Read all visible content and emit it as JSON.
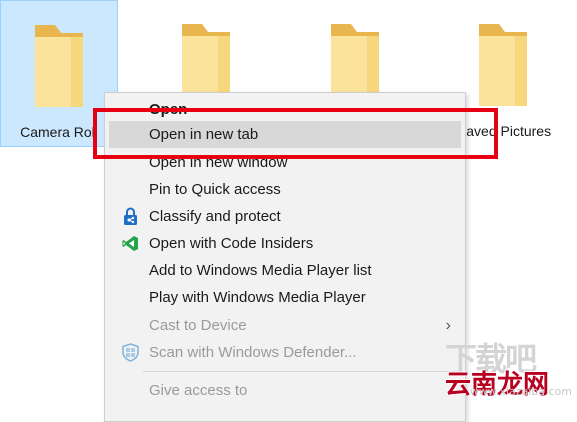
{
  "folders": [
    {
      "label": "Camera Roll",
      "selected": true
    },
    {
      "label": "",
      "selected": false
    },
    {
      "label": "",
      "selected": false
    },
    {
      "label": "Saved Pictures",
      "selected": false
    }
  ],
  "context_menu": {
    "items": [
      {
        "label": "Open",
        "bold": true
      },
      {
        "label": "Open in new tab",
        "hover": true
      },
      {
        "label": "Open in new window"
      },
      {
        "label": "Pin to Quick access"
      },
      {
        "label": "Classify and protect",
        "icon": "azure-information-protection-icon"
      },
      {
        "label": "Open with Code Insiders",
        "icon": "vscode-insiders-icon"
      },
      {
        "label": "Add to Windows Media Player list"
      },
      {
        "label": "Play with Windows Media Player"
      },
      {
        "label": "Cast to Device",
        "disabled": true,
        "submenu": true
      },
      {
        "label": "Scan with Windows Defender...",
        "disabled": true,
        "icon": "windows-defender-shield-icon"
      },
      {
        "label": "Give access to",
        "disabled": true
      }
    ]
  },
  "highlight_color": "#e60012",
  "watermark": {
    "chars": "下载吧",
    "brand": "云南龙网",
    "url": "www.xiazaiba.com"
  }
}
